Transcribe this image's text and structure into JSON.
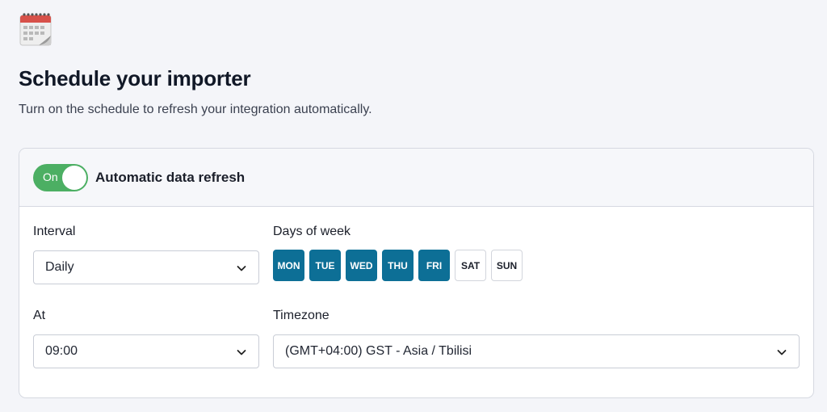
{
  "header": {
    "title": "Schedule your importer",
    "subtitle": "Turn on the schedule to refresh your integration automatically."
  },
  "refresh": {
    "toggle_label": "On",
    "toggle_on": true,
    "label": "Automatic data refresh"
  },
  "interval": {
    "label": "Interval",
    "value": "Daily"
  },
  "days_of_week": {
    "label": "Days of week",
    "days": [
      {
        "label": "MON",
        "selected": true
      },
      {
        "label": "TUE",
        "selected": true
      },
      {
        "label": "WED",
        "selected": true
      },
      {
        "label": "THU",
        "selected": true
      },
      {
        "label": "FRI",
        "selected": true
      },
      {
        "label": "SAT",
        "selected": false
      },
      {
        "label": "SUN",
        "selected": false
      }
    ]
  },
  "at": {
    "label": "At",
    "value": "09:00"
  },
  "timezone": {
    "label": "Timezone",
    "value": "(GMT+04:00) GST - Asia / Tbilisi"
  },
  "colors": {
    "accent": "#0d6f96",
    "toggle_green": "#4caf63"
  },
  "icons": {
    "header": "calendar-icon",
    "select": "chevron-down-icon"
  }
}
